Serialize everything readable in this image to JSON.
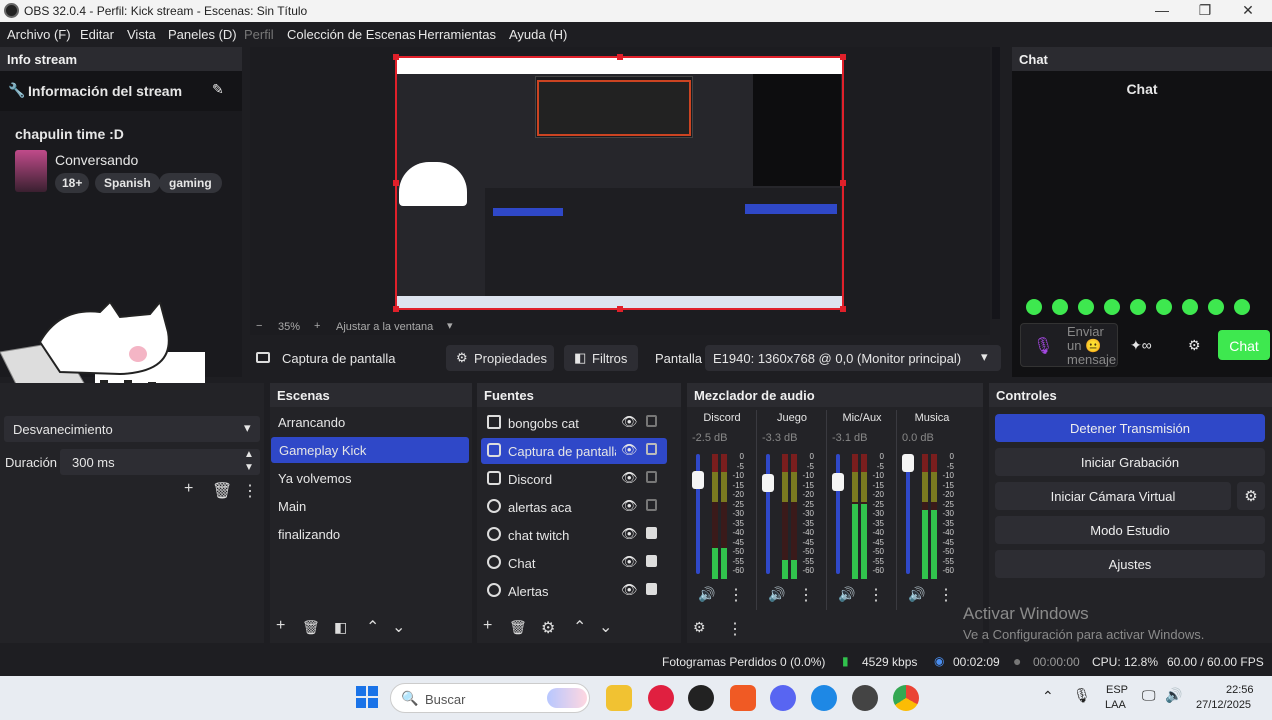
{
  "window": {
    "title": "OBS 32.0.4 - Perfil: Kick stream - Escenas: Sin Título"
  },
  "menu": [
    "Archivo (F)",
    "Editar",
    "Vista",
    "Paneles (D)",
    "Perfil",
    "Colección de Escenas",
    "Herramientas",
    "Ayuda (H)"
  ],
  "info": {
    "dock_title": "Info stream",
    "header": "Información del stream",
    "stream_title": "chapulin time :D",
    "category": "Conversando",
    "tags": [
      "18+",
      "Spanish",
      "gaming"
    ]
  },
  "preview": {
    "zoom": "35%",
    "fit_label": "Ajustar a la ventana"
  },
  "sourcebar": {
    "source_name": "Captura de pantalla",
    "props_label": "Propiedades",
    "filters_label": "Filtros",
    "display_label": "Pantalla",
    "display_value": "E1940: 1360x768 @ 0,0 (Monitor principal)"
  },
  "chat": {
    "dock_title": "Chat",
    "header": "Chat",
    "input_placeholder": "Enviar un 😐 mensaje",
    "send_label": "Chat"
  },
  "transition": {
    "type": "Desvanecimiento",
    "duration_label": "Duración",
    "duration_value": "300 ms"
  },
  "scenes": {
    "title": "Escenas",
    "items": [
      "Arrancando",
      "Gameplay Kick",
      "Ya volvemos",
      "Main",
      "finalizando"
    ],
    "selected": "Gameplay Kick"
  },
  "sources": {
    "title": "Fuentes",
    "items": [
      {
        "name": "bongobs cat",
        "icon": "file-icon"
      },
      {
        "name": "Captura de pantalla",
        "icon": "monitor-icon"
      },
      {
        "name": "Discord",
        "icon": "window-icon"
      },
      {
        "name": "alertas aca",
        "icon": "globe-icon"
      },
      {
        "name": "chat twitch",
        "icon": "globe-icon"
      },
      {
        "name": "Chat",
        "icon": "globe-icon"
      },
      {
        "name": "Alertas",
        "icon": "globe-icon"
      }
    ]
  },
  "mixer": {
    "title": "Mezclador de audio",
    "channels": [
      {
        "name": "Discord",
        "db": "-2.5 dB",
        "level": 0.25,
        "fader": 0.85
      },
      {
        "name": "Juego",
        "db": "-3.3 dB",
        "level": 0.15,
        "fader": 0.82
      },
      {
        "name": "Mic/Aux",
        "db": "-3.1 dB",
        "level": 0.6,
        "fader": 0.83
      },
      {
        "name": "Musica",
        "db": "0.0 dB",
        "level": 0.55,
        "fader": 1.0
      }
    ],
    "scale": [
      "0",
      "-5",
      "-10",
      "-15",
      "-20",
      "-25",
      "-30",
      "-35",
      "-40",
      "-45",
      "-50",
      "-55",
      "-60"
    ]
  },
  "controls": {
    "title": "Controles",
    "buttons": [
      "Detener Transmisión",
      "Iniciar Grabación",
      "Iniciar Cámara Virtual",
      "Modo Estudio",
      "Ajustes"
    ]
  },
  "watermark": {
    "line1": "Activar Windows",
    "line2": "Ve a Configuración para activar Windows."
  },
  "status": {
    "dropped": "Fotogramas Perdidos 0 (0.0%)",
    "bitrate": "4529 kbps",
    "stream_time": "00:02:09",
    "rec_time": "00:00:00",
    "cpu": "CPU: 12.8%",
    "fps": "60.00 / 60.00 FPS"
  },
  "taskbar": {
    "search_placeholder": "Buscar",
    "lang1": "ESP",
    "lang2": "LAA",
    "time": "22:56",
    "date": "27/12/2025"
  }
}
